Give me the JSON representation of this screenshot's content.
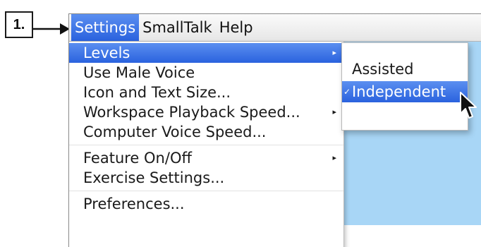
{
  "step": {
    "label": "1."
  },
  "menubar": {
    "items": [
      "Settings",
      "SmallTalk",
      "Help"
    ]
  },
  "settings_menu": {
    "items": [
      {
        "label": "Levels",
        "submenu": true,
        "highlighted": true
      },
      {
        "label": "Use Male Voice",
        "submenu": false
      },
      {
        "label": "Icon and Text Size...",
        "submenu": false
      },
      {
        "label": "Workspace Playback Speed...",
        "submenu": true
      },
      {
        "label": "Computer Voice Speed...",
        "submenu": false
      },
      {
        "label": "Feature On/Off",
        "submenu": true
      },
      {
        "label": "Exercise Settings...",
        "submenu": false
      },
      {
        "label": "Preferences...",
        "submenu": false
      }
    ],
    "submenu_arrow": "▸"
  },
  "levels_submenu": {
    "items": [
      {
        "label": "Assisted",
        "checked": false,
        "highlighted": false
      },
      {
        "label": "Independent",
        "checked": true,
        "highlighted": true
      }
    ],
    "check_mark": "✓"
  },
  "colors": {
    "highlight": "#3a72e6",
    "background": "#a8d6f6"
  }
}
